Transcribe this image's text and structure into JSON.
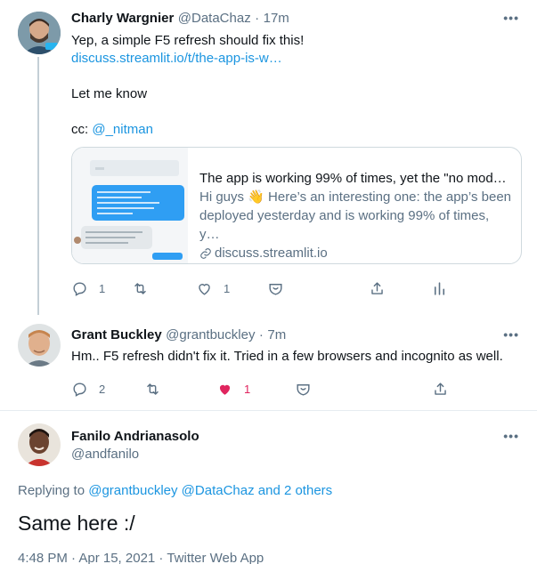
{
  "tweet1": {
    "author_name": "Charly Wargnier",
    "handle": "@DataChaz",
    "sep": "·",
    "time": "17m",
    "line1": "Yep, a simple F5 refresh should fix this!",
    "link": "discuss.streamlit.io/t/the-app-is-w…",
    "line2": "Let me know",
    "cc_prefix": "cc: ",
    "cc_mention": "@_nitman",
    "card": {
      "title": "The app is working 99% of times, yet the \"no modu…",
      "desc_line1": "Hi guys 👋 Here’s an interesting one: the app’s been",
      "desc_line2": "deployed yesterday and is working 99% of times, y…",
      "domain": "discuss.streamlit.io"
    },
    "reply_count": "1",
    "like_count": "1"
  },
  "tweet2": {
    "author_name": "Grant Buckley",
    "handle": "@grantbuckley",
    "sep": "·",
    "time": "7m",
    "text": "Hm.. F5 refresh didn't fix it. Tried in a few browsers and incognito as well.",
    "reply_count": "2",
    "like_count": "1"
  },
  "tweet3": {
    "author_name": "Fanilo Andrianasolo",
    "handle": "@andfanilo",
    "replying_prefix": "Replying to ",
    "replying_mentions": "@grantbuckley @DataChaz and 2 others",
    "text": "Same here :/",
    "meta": "4:48 PM · Apr 15, 2021 · Twitter Web App"
  },
  "more_label": "•••",
  "colors": {
    "accent": "#1b95e0",
    "like": "#e0245e",
    "secondary": "#5b7083"
  }
}
